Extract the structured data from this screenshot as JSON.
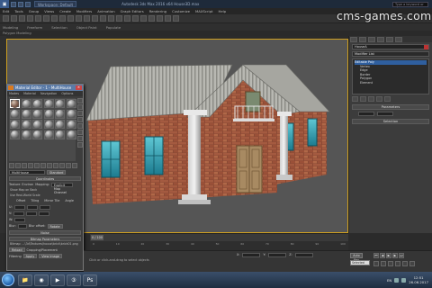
{
  "title_bar": {
    "workspace": "Workspace: Default",
    "window_title": "Autodesk 3ds Max 2016 x64    House3D.max",
    "search_placeholder": "Type a keyword or phrase"
  },
  "menu": {
    "items": [
      "Edit",
      "Tools",
      "Group",
      "Views",
      "Create",
      "Modifiers",
      "Animation",
      "Graph Editors",
      "Rendering",
      "Customize",
      "MAXScript",
      "Help"
    ]
  },
  "ribbon": {
    "tabs": [
      "Modeling",
      "Freeform",
      "Selection",
      "Object Paint",
      "Populate"
    ],
    "sub": "Polygon Modeling"
  },
  "watermark": "cms-games.com",
  "viewport": {
    "label": "[+] [Perspective] [Realistic]"
  },
  "command_panel": {
    "object_name": "HouseA",
    "object_color": "#b03030",
    "modifier_list": "Modifier List",
    "stack": [
      {
        "label": "Editable Poly",
        "selected": true
      },
      {
        "label": "Vertex",
        "selected": false
      },
      {
        "label": "Edge",
        "selected": false
      },
      {
        "label": "Border",
        "selected": false
      },
      {
        "label": "Polygon",
        "selected": false
      },
      {
        "label": "Element",
        "selected": false
      }
    ],
    "rollout_parameters": "Parameters",
    "rollout_selection": "Selection"
  },
  "material_editor": {
    "title": "Material Editor - 1 - MultiHouse",
    "menu": [
      "Modes",
      "Material",
      "Navigation",
      "Options",
      "Utilities"
    ],
    "material_name": "MultiHouse",
    "material_type": "Standard",
    "rollout_coords": "Coordinates",
    "texture_label": "Texture",
    "environ_label": "Environ",
    "mapping_label": "Mapping:",
    "mapping_value": "Explicit Map Channel",
    "show_map": "Show Map on Back",
    "use_real": "Use Real-World Scale",
    "grid_headers": [
      "Offset",
      "Tiling",
      "Mirror Tile",
      "Angle"
    ],
    "u_label": "U:",
    "v_label": "V:",
    "w_label": "W:",
    "blur_label": "Blur:",
    "blur_offset": "Blur offset:",
    "rotate": "Rotate",
    "noise": "Noise",
    "bitmap_params": "Bitmap Parameters",
    "bitmap_path": "Bitmap: ...\\3d\\Textures\\house\\brick\\brick01.png",
    "reload": "Reload",
    "cropping": "Cropping/Placement",
    "filtering": "Filtering",
    "apply": "Apply",
    "view_image": "View Image"
  },
  "timeline": {
    "frame": "0 / 100",
    "ticks": [
      "0",
      "10",
      "20",
      "30",
      "40",
      "50",
      "60",
      "70",
      "80",
      "90",
      "100"
    ]
  },
  "status": {
    "message": "Click or click-and-drag to select objects",
    "auto_key": "Auto Key",
    "selected": "Selected",
    "coord_labels": [
      "X:",
      "Y:",
      "Z:"
    ]
  },
  "taskbar": {
    "time": "12:51",
    "date": "26.06.2017",
    "lang": "EN"
  }
}
